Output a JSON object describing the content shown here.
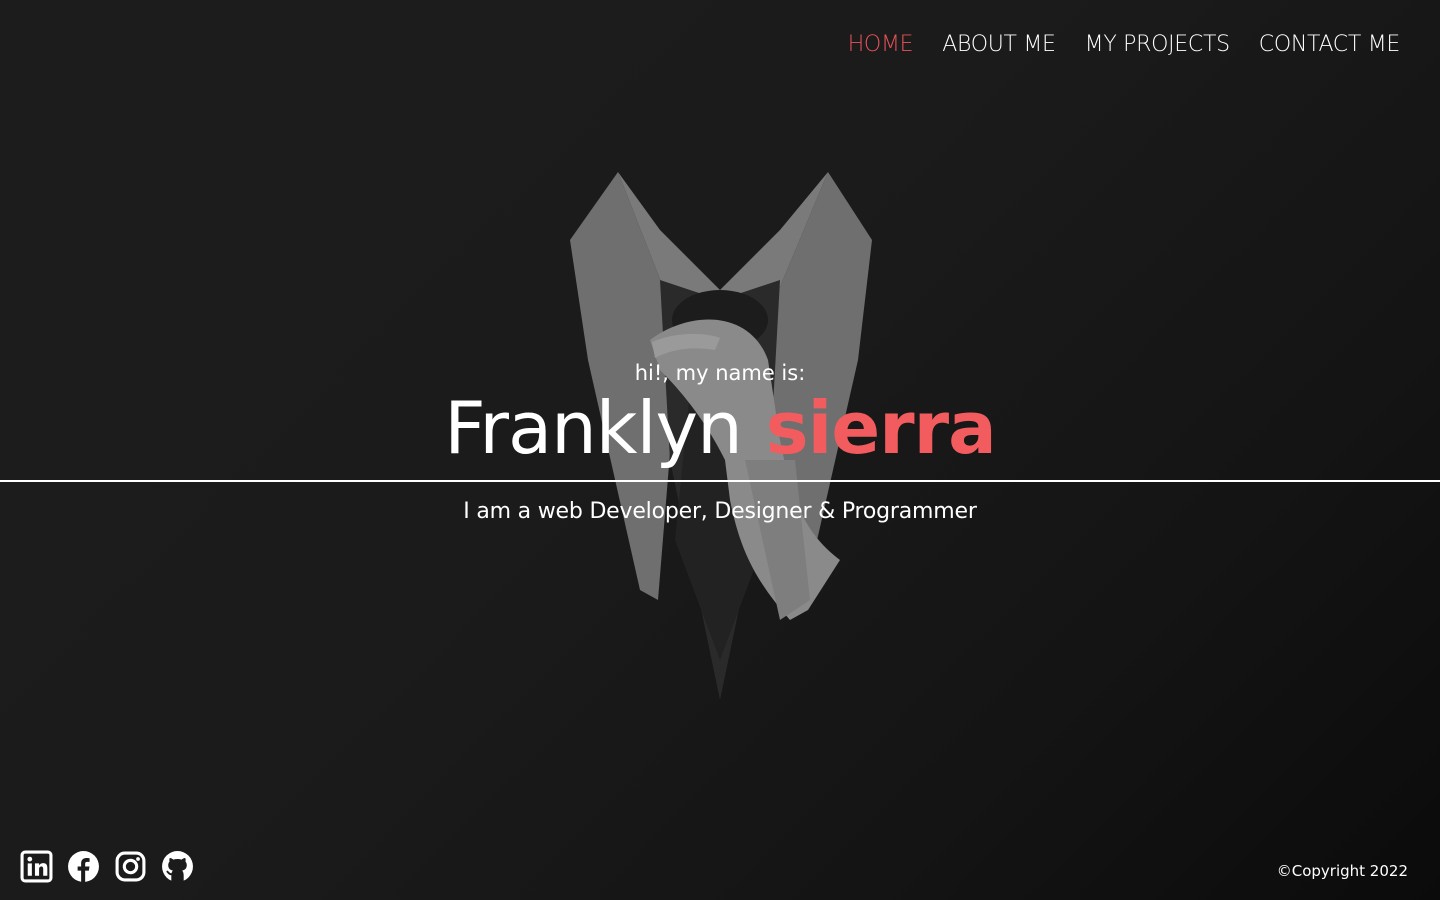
{
  "nav": {
    "items": [
      {
        "label": "HOME",
        "active": true
      },
      {
        "label": "ABOUT ME",
        "active": false
      },
      {
        "label": "MY PROJECTS",
        "active": false
      },
      {
        "label": "CONTACT ME",
        "active": false
      }
    ]
  },
  "hero": {
    "greeting": "hi!, my name is:",
    "first_name": "Franklyn",
    "last_name": "sierra",
    "tagline": "I am a web Developer, Designer & Programmer"
  },
  "footer": {
    "social_icons": [
      "linkedin-icon",
      "facebook-icon",
      "instagram-icon",
      "github-icon"
    ],
    "copyright": "©Copyright 2022"
  },
  "colors": {
    "accent": "#f25c5f",
    "nav_active": "#e5525a",
    "background": "#1b1b1b",
    "text": "#ffffff"
  }
}
